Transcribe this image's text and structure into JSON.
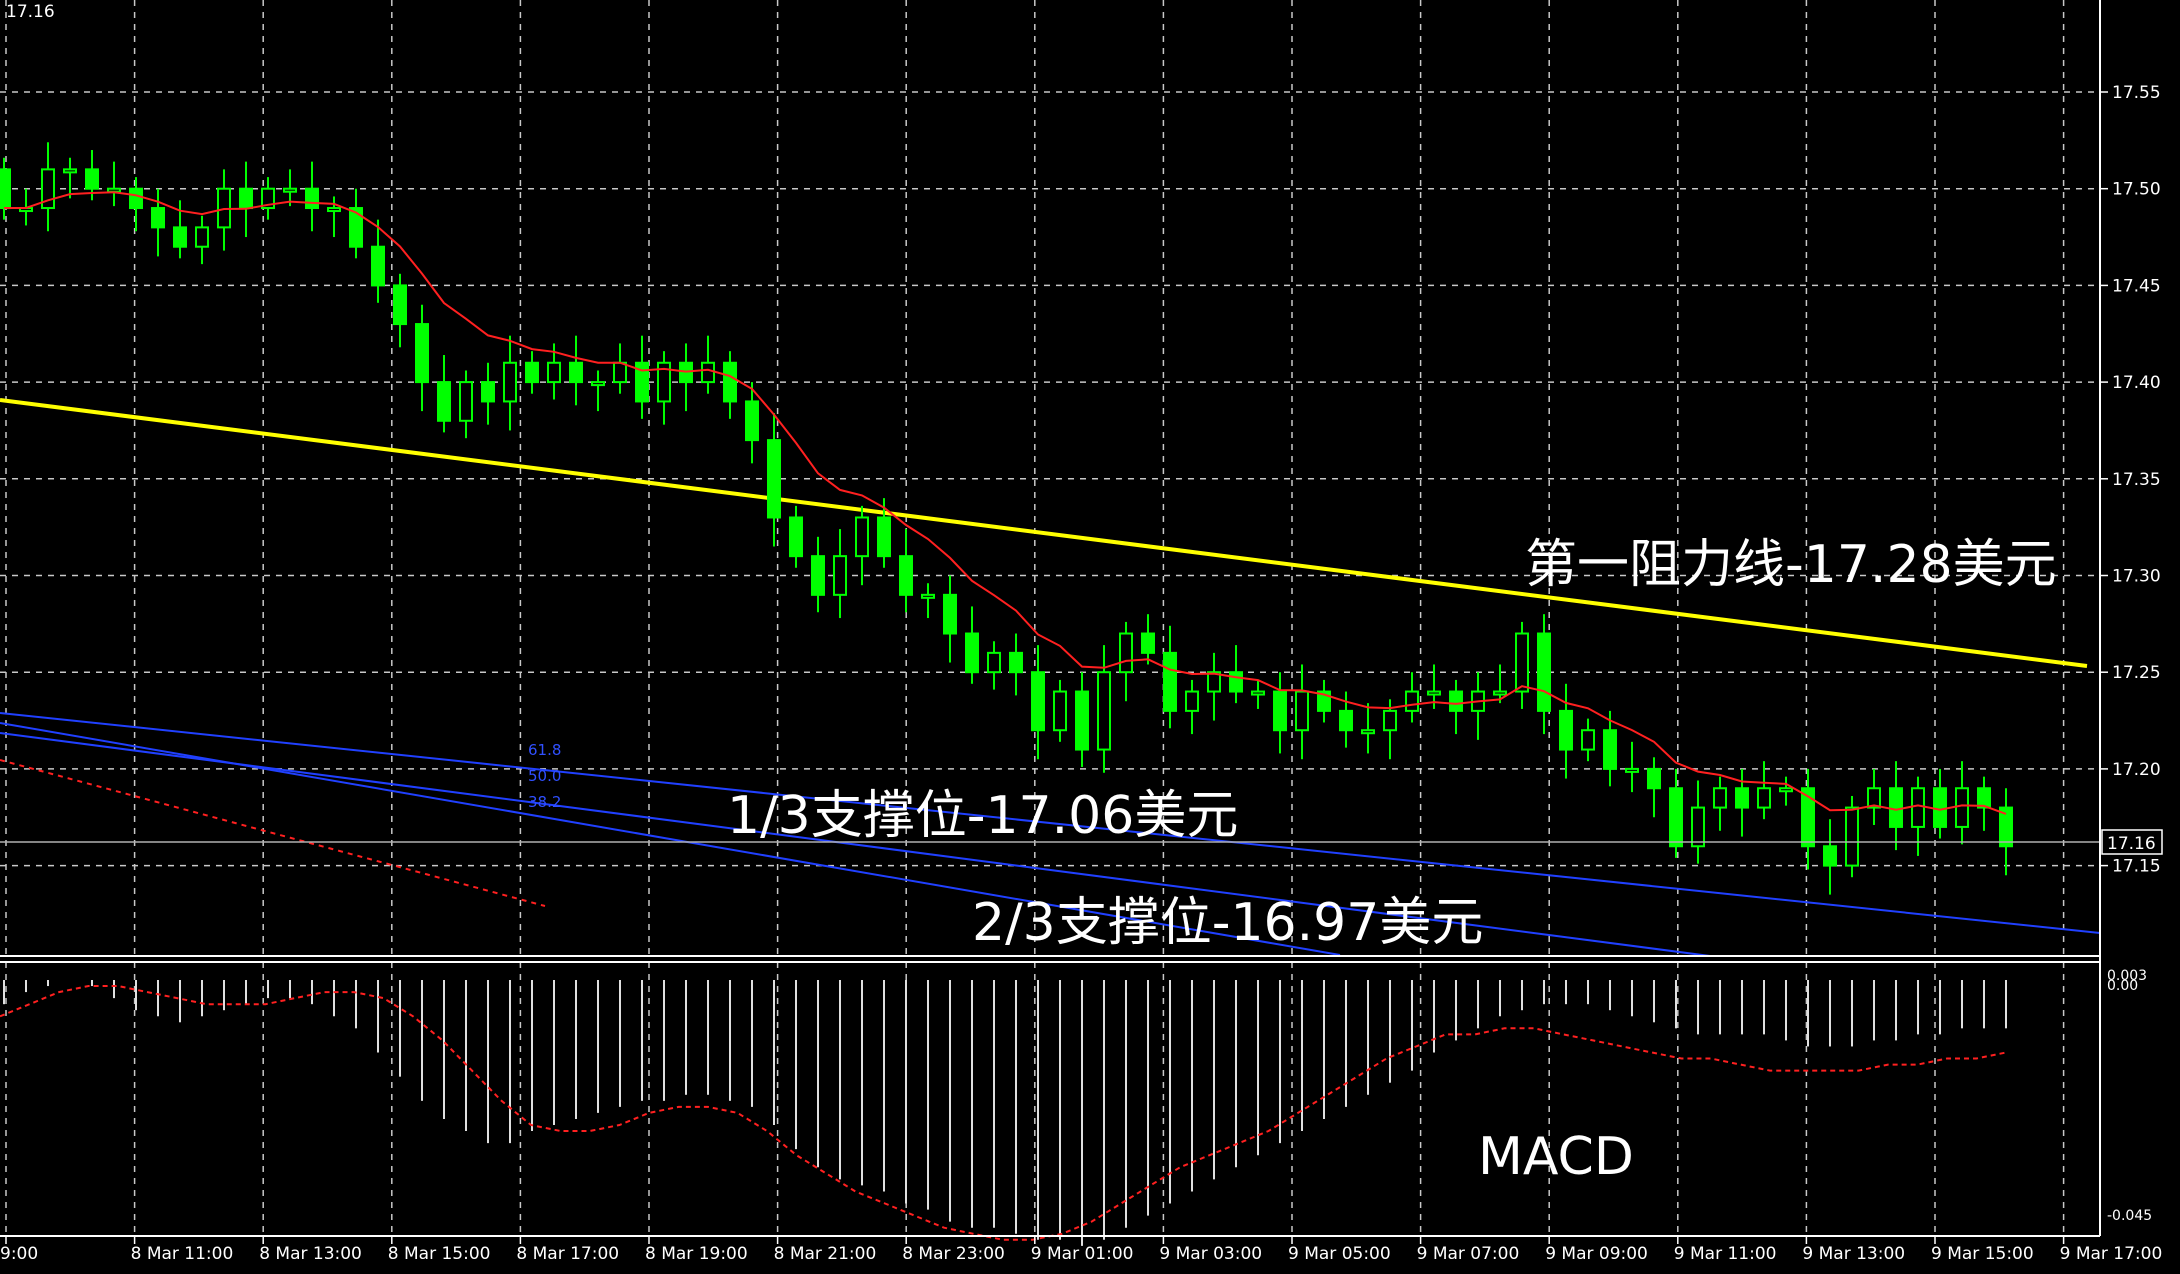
{
  "chart_data": [
    {
      "type": "candlestick",
      "symbol_price_label": "17.16",
      "price_levels": [
        "17.55",
        "17.50",
        "17.45",
        "17.40",
        "17.35",
        "17.30",
        "17.25",
        "17.20",
        "17.15"
      ],
      "current_price": "17.16",
      "ylim": [
        17.1,
        17.59
      ],
      "x_labels": [
        "9:00",
        "8 Mar 11:00",
        "8 Mar 13:00",
        "8 Mar 15:00",
        "8 Mar 17:00",
        "8 Mar 19:00",
        "8 Mar 21:00",
        "8 Mar 23:00",
        "9 Mar 01:00",
        "9 Mar 03:00",
        "9 Mar 05:00",
        "9 Mar 07:00",
        "9 Mar 09:00",
        "9 Mar 11:00",
        "9 Mar 13:00",
        "9 Mar 15:00",
        "9 Mar 17:00"
      ],
      "closes": [
        17.49,
        17.49,
        17.51,
        17.51,
        17.5,
        17.5,
        17.49,
        17.48,
        17.47,
        17.48,
        17.5,
        17.49,
        17.5,
        17.5,
        17.49,
        17.49,
        17.47,
        17.45,
        17.43,
        17.4,
        17.38,
        17.4,
        17.39,
        17.41,
        17.4,
        17.41,
        17.4,
        17.4,
        17.41,
        17.39,
        17.41,
        17.4,
        17.41,
        17.39,
        17.37,
        17.33,
        17.31,
        17.29,
        17.31,
        17.33,
        17.31,
        17.29,
        17.29,
        17.27,
        17.25,
        17.26,
        17.25,
        17.22,
        17.24,
        17.21,
        17.25,
        17.27,
        17.26,
        17.23,
        17.24,
        17.25,
        17.24,
        17.24,
        17.22,
        17.24,
        17.23,
        17.22,
        17.22,
        17.23,
        17.24,
        17.24,
        17.23,
        17.24,
        17.24,
        17.27,
        17.23,
        17.21,
        17.22,
        17.2,
        17.2,
        17.19,
        17.16,
        17.18,
        17.19,
        17.18,
        17.19,
        17.19,
        17.16,
        17.15,
        17.18,
        17.19,
        17.17,
        17.19,
        17.17,
        17.19,
        17.18,
        17.16
      ],
      "ema_label": "",
      "trend_lines": [
        {
          "color": "#ffff00",
          "label": "第一阻力线-17.28美元"
        },
        {
          "color": "#2040ff",
          "label": "1/3支撑位-17.06美元"
        },
        {
          "color": "#2040ff",
          "label": "2/3支撑位-16.97美元"
        }
      ],
      "fibo_levels": [
        "61.8",
        "50.0",
        "38.2"
      ],
      "colors": {
        "background": "#000000",
        "grid": "#c0c0c0",
        "candle": "#00ff00",
        "ma": "#ff2020",
        "resistance": "#ffff00",
        "channel": "#2040ff"
      }
    },
    {
      "type": "bar",
      "name": "MACD",
      "axis_labels": [
        "0.003",
        "0.00",
        "-0.045"
      ],
      "histogram": [
        -0.004,
        -0.002,
        -0.001,
        0.0,
        -0.001,
        -0.003,
        -0.005,
        -0.006,
        -0.007,
        -0.006,
        -0.005,
        -0.004,
        -0.003,
        -0.003,
        -0.004,
        -0.006,
        -0.008,
        -0.012,
        -0.016,
        -0.02,
        -0.023,
        -0.025,
        -0.027,
        -0.027,
        -0.025,
        -0.024,
        -0.023,
        -0.022,
        -0.021,
        -0.02,
        -0.02,
        -0.019,
        -0.019,
        -0.02,
        -0.021,
        -0.024,
        -0.028,
        -0.031,
        -0.033,
        -0.034,
        -0.035,
        -0.037,
        -0.038,
        -0.04,
        -0.041,
        -0.041,
        -0.042,
        -0.043,
        -0.043,
        -0.044,
        -0.043,
        -0.041,
        -0.039,
        -0.037,
        -0.035,
        -0.033,
        -0.031,
        -0.029,
        -0.027,
        -0.025,
        -0.023,
        -0.021,
        -0.019,
        -0.017,
        -0.015,
        -0.012,
        -0.01,
        -0.008,
        -0.006,
        -0.005,
        -0.004,
        -0.004,
        -0.004,
        -0.005,
        -0.006,
        -0.007,
        -0.008,
        -0.009,
        -0.009,
        -0.009,
        -0.009,
        -0.01,
        -0.011,
        -0.011,
        -0.011,
        -0.01,
        -0.01,
        -0.009,
        -0.009,
        -0.008,
        -0.008,
        -0.008
      ],
      "signal": [
        -0.006,
        -0.004,
        -0.002,
        -0.001,
        -0.001,
        -0.002,
        -0.003,
        -0.004,
        -0.004,
        -0.004,
        -0.003,
        -0.002,
        -0.002,
        -0.003,
        -0.006,
        -0.01,
        -0.015,
        -0.02,
        -0.024,
        -0.025,
        -0.025,
        -0.024,
        -0.022,
        -0.021,
        -0.021,
        -0.022,
        -0.025,
        -0.029,
        -0.032,
        -0.035,
        -0.037,
        -0.039,
        -0.041,
        -0.042,
        -0.043,
        -0.043,
        -0.042,
        -0.04,
        -0.037,
        -0.034,
        -0.031,
        -0.029,
        -0.027,
        -0.025,
        -0.022,
        -0.019,
        -0.016,
        -0.013,
        -0.011,
        -0.009,
        -0.009,
        -0.008,
        -0.008,
        -0.009,
        -0.01,
        -0.011,
        -0.012,
        -0.013,
        -0.013,
        -0.014,
        -0.015,
        -0.015,
        -0.015,
        -0.015,
        -0.014,
        -0.014,
        -0.013,
        -0.013,
        -0.012
      ],
      "label": "MACD"
    }
  ]
}
